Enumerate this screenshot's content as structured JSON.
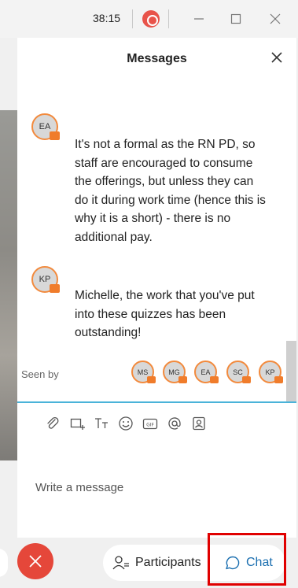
{
  "titlebar": {
    "timer": "38:15",
    "icons": [
      "record-icon",
      "minimize-icon",
      "maximize-icon",
      "close-icon"
    ]
  },
  "panel": {
    "title": "Messages"
  },
  "messages": [
    {
      "initials": "EA",
      "text": "It's not a formal as the RN PD, so staff are encouraged to consume the offerings, but unless they can do it during work time (hence this is why it is a short) - there is no additional pay."
    },
    {
      "initials": "KP",
      "text": "Michelle, the work that you've put into these quizzes has been outstanding!"
    }
  ],
  "seen_by": {
    "label": "Seen by",
    "avatars": [
      "MS",
      "MG",
      "EA",
      "SC",
      "KP"
    ]
  },
  "toolbar": {
    "tools": [
      "attach-icon",
      "screenshot-icon",
      "text-format-icon",
      "emoji-icon",
      "gif-icon",
      "mention-icon",
      "contact-card-icon"
    ]
  },
  "composer": {
    "placeholder": "Write a message"
  },
  "bottombar": {
    "participants_label": "Participants",
    "chat_label": "Chat"
  },
  "colors": {
    "accent": "#1b6fb0",
    "end_call": "#e5473a",
    "avatar_ring": "#f28a3d",
    "divider": "#4ab3d9",
    "highlight": "#e00000"
  }
}
